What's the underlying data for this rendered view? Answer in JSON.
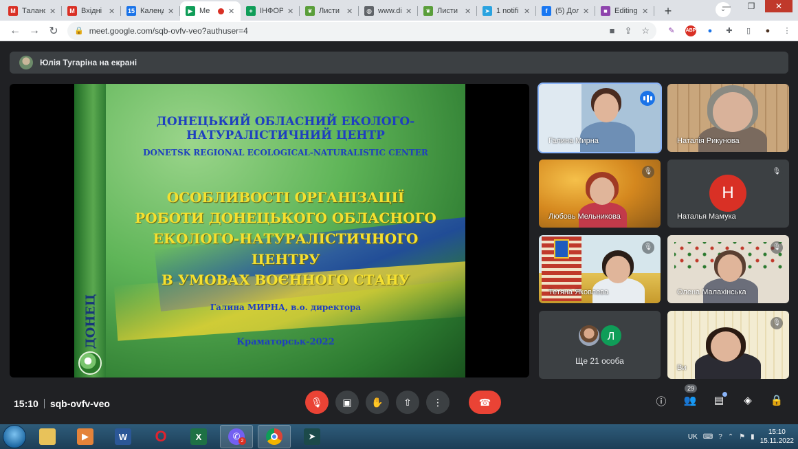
{
  "browser": {
    "tabs": [
      {
        "label": "Талано",
        "icon": "gmail-icon",
        "color": "#d93025",
        "glyph": "M"
      },
      {
        "label": "Вхідні",
        "icon": "gmail-icon",
        "color": "#d93025",
        "glyph": "M"
      },
      {
        "label": "Календ",
        "icon": "calendar-icon",
        "color": "#1a73e8",
        "glyph": "15"
      },
      {
        "label": "Ме",
        "icon": "meet-icon",
        "color": "#0f9d58",
        "glyph": "▶",
        "active": true
      },
      {
        "label": "ІНФОР",
        "icon": "sheets-icon",
        "color": "#0f9d58",
        "glyph": "+"
      },
      {
        "label": "Листи",
        "icon": "leaf-icon",
        "color": "#5a9e3a",
        "glyph": "❦"
      },
      {
        "label": "www.di",
        "icon": "globe-icon",
        "color": "#5f6368",
        "glyph": "◍"
      },
      {
        "label": "Листи",
        "icon": "leaf-icon",
        "color": "#5a9e3a",
        "glyph": "❦"
      },
      {
        "label": "1 notifi",
        "icon": "telegram-icon",
        "color": "#2aa3e0",
        "glyph": "➤"
      },
      {
        "label": "(5) Дол",
        "icon": "facebook-icon",
        "color": "#1877f2",
        "glyph": "f"
      },
      {
        "label": "Editing",
        "icon": "editor-icon",
        "color": "#8e44ad",
        "glyph": "■"
      }
    ],
    "url": "meet.google.com/sqb-ovfv-veo?authuser=4"
  },
  "meet": {
    "presenter_label": "Юлія Тугаріна на екрані",
    "slide": {
      "title_line1": "ДОНЕЦЬКИЙ ОБЛАСНИЙ ЕКОЛОГО-",
      "title_line2": "НАТУРАЛІСТИЧНИЙ ЦЕНТР",
      "subtitle_en": "DONETSK REGIONAL ECOLOGICAL-NATURALISTIC CENTER",
      "heading_line1": "ОСОБЛИВОСТІ ОРГАНІЗАЦІЇ",
      "heading_line2": "РОБОТИ ДОНЕЦЬКОГО ОБЛАСНОГО",
      "heading_line3": "ЕКОЛОГО-НАТУРАЛІСТИЧНОГО",
      "heading_line4": "ЦЕНТРУ",
      "heading_line5": "В УМОВАХ ВОЄННОГО СТАНУ",
      "author": "Галина МИРНА, в.о. директора",
      "place_year": "Краматорськ-2022",
      "side_logo_text": "ДОНЕЦ"
    },
    "participants": [
      {
        "name": "Галина Мирна",
        "speaking": true
      },
      {
        "name": "Наталія Рикунова"
      },
      {
        "name": "Любовь Мельникова",
        "muted": true
      },
      {
        "name": "Наталья Мамука",
        "muted": true,
        "avatar_letter": "Н"
      },
      {
        "name": "Тетяна Яковлева",
        "muted": true
      },
      {
        "name": "Олена Малахінська",
        "muted": true
      },
      {
        "name": "Ви",
        "muted": true
      }
    ],
    "others": {
      "label": "Ще 21 особа",
      "avatar_letter": "Л"
    },
    "time": "15:10",
    "meeting_code": "sqb-ovfv-veo",
    "people_count": "29"
  },
  "taskbar": {
    "lang": "UK",
    "time": "15:10",
    "date": "15.11.2022",
    "viber_count": "2"
  }
}
